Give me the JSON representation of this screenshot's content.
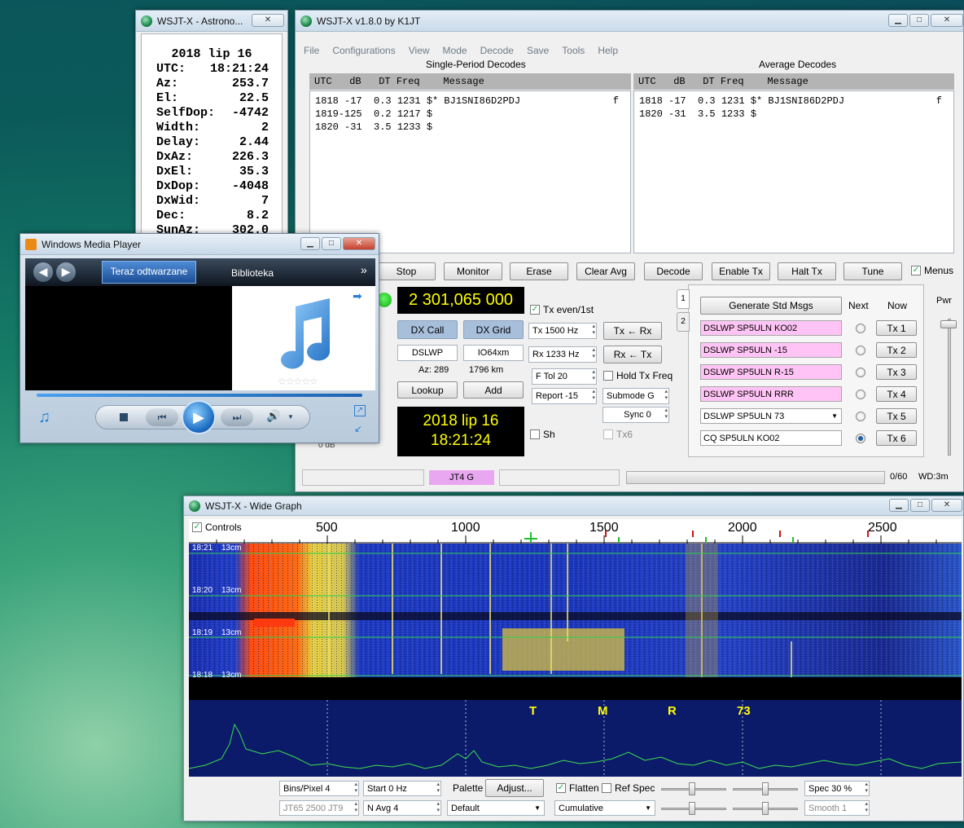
{
  "astro": {
    "title": "WSJT-X - Astrono...",
    "date": "2018 lip 16",
    "rows": [
      {
        "k": "UTC:",
        "v": "18:21:24"
      },
      {
        "k": "Az:",
        "v": "253.7"
      },
      {
        "k": "El:",
        "v": "22.5"
      },
      {
        "k": "SelfDop:",
        "v": "-4742"
      },
      {
        "k": "Width:",
        "v": "2"
      },
      {
        "k": "Delay:",
        "v": "2.44"
      },
      {
        "k": "DxAz:",
        "v": "226.3"
      },
      {
        "k": "DxEl:",
        "v": "35.3"
      },
      {
        "k": "DxDop:",
        "v": "-4048"
      },
      {
        "k": "DxWid:",
        "v": "7"
      },
      {
        "k": "Dec:",
        "v": "8.2"
      },
      {
        "k": "SunAz:",
        "v": "302.0"
      }
    ]
  },
  "main": {
    "title": "WSJT-X   v1.8.0   by K1JT",
    "menu": [
      "File",
      "Configurations",
      "View",
      "Mode",
      "Decode",
      "Save",
      "Tools",
      "Help"
    ],
    "single_title": "Single-Period Decodes",
    "average_title": "Average Decodes",
    "decode_header": "UTC   dB   DT Freq    Message",
    "single_lines": [
      {
        "text": "1818 -17  0.3 1231 $* BJ1SNI86D2PDJ",
        "flag": "f"
      },
      {
        "text": "1819-125  0.2 1217 $",
        "flag": ""
      },
      {
        "text": "1820 -31  3.5 1233 $",
        "flag": ""
      }
    ],
    "average_lines": [
      {
        "text": "1818 -17  0.3 1231 $* BJ1SNI86D2PDJ",
        "flag": "f"
      },
      {
        "text": "1820 -31  3.5 1233 $",
        "flag": ""
      }
    ],
    "buttons": {
      "stop": "Stop",
      "monitor": "Monitor",
      "erase": "Erase",
      "clear_avg": "Clear Avg",
      "decode": "Decode",
      "enable_tx": "Enable Tx",
      "halt_tx": "Halt Tx",
      "tune": "Tune"
    },
    "menus_label": "Menus",
    "frequency": "2 301,065 000",
    "dx_call_btn": "DX Call",
    "dx_grid_btn": "DX Grid",
    "dx_call": "DSLWP",
    "dx_grid": "IO64xm",
    "az": "Az: 289",
    "dist": "1796 km",
    "lookup": "Lookup",
    "add": "Add",
    "clock_date": "2018 lip 16",
    "clock_time": "18:21:24",
    "tx_even": "Tx even/1st",
    "tx_freq": "Tx  1500  Hz",
    "rx_freq": "Rx  1233  Hz",
    "tx_rx_btn": "Tx ← Rx",
    "rx_tx_btn": "Rx ← Tx",
    "ftol": "F Tol  20",
    "hold_tx": "Hold Tx Freq",
    "report": "Report -15",
    "submode": "Submode G",
    "sync": "Sync  0",
    "sh": "Sh",
    "tx6_chk": "Tx6",
    "db_label": "0 dB",
    "tab1": "1",
    "tab2": "2",
    "gen_std": "Generate Std Msgs",
    "next": "Next",
    "now": "Now",
    "pwr": "Pwr",
    "msgs": [
      "DSLWP SP5ULN KO02",
      "DSLWP SP5ULN -15",
      "DSLWP SP5ULN R-15",
      "DSLWP SP5ULN RRR",
      "DSLWP SP5ULN 73",
      "CQ SP5ULN KO02"
    ],
    "tx_btns": [
      "Tx 1",
      "Tx 2",
      "Tx 3",
      "Tx 4",
      "Tx 5",
      "Tx 6"
    ],
    "status_mode": "JT4 G",
    "status_count": "0/60",
    "status_wd": "WD:3m"
  },
  "wmp": {
    "title": "Windows Media Player",
    "tab_now": "Teraz odtwarzane",
    "tab_lib": "Biblioteka",
    "more": "»"
  },
  "wide": {
    "title": "WSJT-X - Wide Graph",
    "controls": "Controls",
    "ticks": [
      "500",
      "1000",
      "1500",
      "2000",
      "2500"
    ],
    "time_labels": [
      "18:21",
      "18:20",
      "18:19",
      "18:18"
    ],
    "band_label": "13cm",
    "markers": [
      "T",
      "M",
      "R",
      "73"
    ],
    "bins": "Bins/Pixel  4",
    "start": "Start  0 Hz",
    "palette": "Palette",
    "adjust": "Adjust...",
    "default": "Default",
    "flatten": "Flatten",
    "refspec": "Ref Spec",
    "spec": "Spec  30 %",
    "jt65": "JT65   2500   JT9",
    "navg": "N Avg  4",
    "cumulative": "Cumulative",
    "smooth": "Smooth   1"
  },
  "colors": {
    "accent": "#1d5fa8",
    "freq_bg": "#000000",
    "freq_fg": "#ffff00",
    "mode_bg": "#e8a7f0",
    "msg_bg": "#ffc4f5",
    "dx_btn": "#a8bfdc"
  }
}
